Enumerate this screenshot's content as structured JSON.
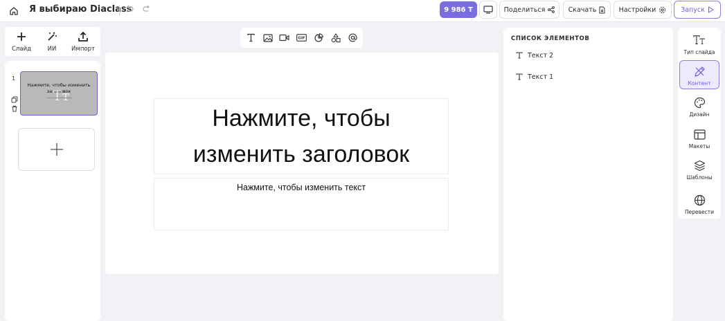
{
  "topbar": {
    "title": "Я выбираю Diaclass",
    "tokens": "9 986 Т",
    "share": "Поделиться",
    "download": "Скачать",
    "settings": "Настройки",
    "launch": "Запуск"
  },
  "tools": {
    "slide": "Слайд",
    "ai": "ИИ",
    "import": "Импорт"
  },
  "slides": {
    "items": [
      {
        "number": "1",
        "title": "Нажмите, чтобы изменить заголовок"
      }
    ]
  },
  "canvas": {
    "title": "Нажмите, чтобы изменить заголовок",
    "body": "Нажмите, чтобы изменить текст"
  },
  "elements": {
    "heading": "СПИСОК ЭЛЕМЕНТОВ",
    "items": [
      "Текст 2",
      "Текст 1"
    ]
  },
  "rail": {
    "slide_type": "Тип слайда",
    "content": "Контент",
    "design": "Дизайн",
    "layouts": "Макеты",
    "templates": "Шаблоны",
    "translate": "Перевести"
  },
  "colors": {
    "accent": "#7b6ce0",
    "canvas_bg": "#f1f1f6",
    "thumb_bg": "#b9b9b9"
  }
}
